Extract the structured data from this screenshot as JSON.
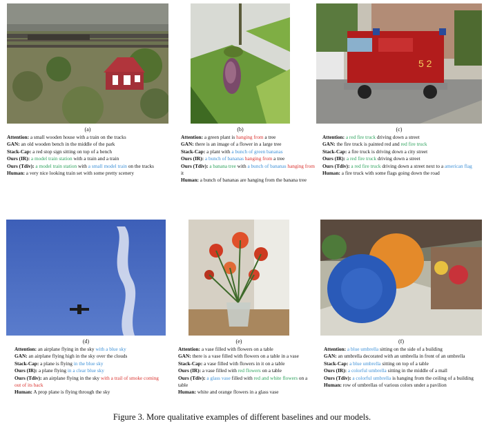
{
  "figure_caption": "Figure 3. More qualitative examples of different baselines and our models.",
  "panels": [
    {
      "label": "(a)",
      "captions": [
        {
          "method": "Attention:",
          "segments": [
            {
              "t": " a small wooden house with a train on the tracks",
              "c": ""
            }
          ]
        },
        {
          "method": "GAN:",
          "segments": [
            {
              "t": " an old wooden bench in the middle of the park",
              "c": ""
            }
          ]
        },
        {
          "method": "Stack-Cap:",
          "segments": [
            {
              "t": " a red stop sign sitting on top of a bench",
              "c": ""
            }
          ]
        },
        {
          "method": "Ours (IR):",
          "segments": [
            {
              "t": " ",
              "c": ""
            },
            {
              "t": "a model train station",
              "c": "g"
            },
            {
              "t": " with a train and a train",
              "c": ""
            }
          ]
        },
        {
          "method": "Ours (Tdiv):",
          "segments": [
            {
              "t": " ",
              "c": ""
            },
            {
              "t": "a model train station",
              "c": "g"
            },
            {
              "t": " with ",
              "c": ""
            },
            {
              "t": "a small model train",
              "c": "b"
            },
            {
              "t": " on the tracks",
              "c": ""
            }
          ]
        },
        {
          "method": "Human:",
          "segments": [
            {
              "t": " a very nice looking train set with some pretty scenery",
              "c": ""
            }
          ]
        }
      ]
    },
    {
      "label": "(b)",
      "captions": [
        {
          "method": "Attention:",
          "segments": [
            {
              "t": " a green plant is ",
              "c": ""
            },
            {
              "t": "hanging from",
              "c": "r"
            },
            {
              "t": " a tree",
              "c": ""
            }
          ]
        },
        {
          "method": "GAN:",
          "segments": [
            {
              "t": " there is an image of a flower in a large tree",
              "c": ""
            }
          ]
        },
        {
          "method": "Stack-Cap:",
          "segments": [
            {
              "t": " a plant with ",
              "c": ""
            },
            {
              "t": "a bunch of green bananas",
              "c": "b"
            }
          ]
        },
        {
          "method": "Ours (IR):",
          "segments": [
            {
              "t": " ",
              "c": ""
            },
            {
              "t": "a bunch of bananas",
              "c": "b"
            },
            {
              "t": " ",
              "c": ""
            },
            {
              "t": "hanging from",
              "c": "r"
            },
            {
              "t": " a tree",
              "c": ""
            }
          ]
        },
        {
          "method": "Ours (Tdiv):",
          "segments": [
            {
              "t": " ",
              "c": ""
            },
            {
              "t": "a banana tree",
              "c": "g"
            },
            {
              "t": " with ",
              "c": ""
            },
            {
              "t": "a bunch of bananas",
              "c": "b"
            },
            {
              "t": " ",
              "c": ""
            },
            {
              "t": "hanging from",
              "c": "r"
            },
            {
              "t": " it",
              "c": ""
            }
          ]
        },
        {
          "method": "Human:",
          "segments": [
            {
              "t": " a bunch of bananas are hanging from the banana tree",
              "c": ""
            }
          ]
        }
      ]
    },
    {
      "label": "(c)",
      "captions": [
        {
          "method": "Attention:",
          "segments": [
            {
              "t": " ",
              "c": ""
            },
            {
              "t": "a red fire truck",
              "c": "g"
            },
            {
              "t": " driving down a street",
              "c": ""
            }
          ]
        },
        {
          "method": "GAN:",
          "segments": [
            {
              "t": " the fire truck is painted red and ",
              "c": ""
            },
            {
              "t": "red fire truck",
              "c": "g"
            }
          ]
        },
        {
          "method": "Stack-Cap:",
          "segments": [
            {
              "t": " a fire truck is driving down a city street",
              "c": ""
            }
          ]
        },
        {
          "method": "Ours (IR):",
          "segments": [
            {
              "t": " ",
              "c": ""
            },
            {
              "t": "a red fire truck",
              "c": "g"
            },
            {
              "t": " driving down a street",
              "c": ""
            }
          ]
        },
        {
          "method": "Ours (Tdiv):",
          "segments": [
            {
              "t": " ",
              "c": ""
            },
            {
              "t": "a red fire truck",
              "c": "g"
            },
            {
              "t": " driving down a street next to a ",
              "c": ""
            },
            {
              "t": "american flag",
              "c": "b"
            }
          ]
        },
        {
          "method": "Human:",
          "segments": [
            {
              "t": " a fire truck with some flags going down the road",
              "c": ""
            }
          ]
        }
      ]
    },
    {
      "label": "(d)",
      "captions": [
        {
          "method": "Attention:",
          "segments": [
            {
              "t": " an airplane flying in the sky ",
              "c": ""
            },
            {
              "t": "with a blue sky",
              "c": "b"
            }
          ]
        },
        {
          "method": "GAN:",
          "segments": [
            {
              "t": " an airplane flying high in the sky over the clouds",
              "c": ""
            }
          ]
        },
        {
          "method": "Stack-Cap:",
          "segments": [
            {
              "t": " a plane is flying ",
              "c": ""
            },
            {
              "t": "in the blue sky",
              "c": "b"
            }
          ]
        },
        {
          "method": "Ours (IR):",
          "segments": [
            {
              "t": " a plane flying ",
              "c": ""
            },
            {
              "t": "in a clear blue sky",
              "c": "b"
            }
          ]
        },
        {
          "method": "Ours (Tdiv):",
          "segments": [
            {
              "t": " an airplane flying in the sky ",
              "c": ""
            },
            {
              "t": "with a trail of smoke coming out of its back",
              "c": "r"
            }
          ]
        },
        {
          "method": "Human:",
          "segments": [
            {
              "t": " A prop plane is flying through the sky",
              "c": ""
            }
          ]
        }
      ]
    },
    {
      "label": "(e)",
      "captions": [
        {
          "method": "Attention:",
          "segments": [
            {
              "t": " a vase filled with flowers on a table",
              "c": ""
            }
          ]
        },
        {
          "method": "GAN:",
          "segments": [
            {
              "t": " there is a vase filled with flowers on a table in a vase",
              "c": ""
            }
          ]
        },
        {
          "method": "Stack-Cap:",
          "segments": [
            {
              "t": " a vase filled with flowers in it on a table",
              "c": ""
            }
          ]
        },
        {
          "method": "Ours (IR):",
          "segments": [
            {
              "t": " a vase filled with ",
              "c": ""
            },
            {
              "t": "red flowers",
              "c": "g"
            },
            {
              "t": " on a table",
              "c": ""
            }
          ]
        },
        {
          "method": "Ours (Tdiv):",
          "segments": [
            {
              "t": " ",
              "c": ""
            },
            {
              "t": "a glass vase",
              "c": "b"
            },
            {
              "t": " filled with ",
              "c": ""
            },
            {
              "t": "red and white flowers",
              "c": "g"
            },
            {
              "t": " on a table",
              "c": ""
            }
          ]
        },
        {
          "method": "Human:",
          "segments": [
            {
              "t": " white and orange flowers in a glass vase",
              "c": ""
            }
          ]
        }
      ]
    },
    {
      "label": "(f)",
      "captions": [
        {
          "method": "Attention:",
          "segments": [
            {
              "t": " ",
              "c": ""
            },
            {
              "t": "a blue umbrella",
              "c": "b"
            },
            {
              "t": " sitting on the side of a building",
              "c": ""
            }
          ]
        },
        {
          "method": "GAN:",
          "segments": [
            {
              "t": " an umbrella decorated with an umbrella in front of an umbrella",
              "c": ""
            }
          ]
        },
        {
          "method": "Stack-Cap:",
          "segments": [
            {
              "t": " ",
              "c": ""
            },
            {
              "t": "a blue umbrella",
              "c": "b"
            },
            {
              "t": " sitting on top of a table",
              "c": ""
            }
          ]
        },
        {
          "method": "Ours (IR):",
          "segments": [
            {
              "t": " ",
              "c": ""
            },
            {
              "t": "a colorful umbrella",
              "c": "b"
            },
            {
              "t": " sitting in the middle of a mall",
              "c": ""
            }
          ]
        },
        {
          "method": "Ours (Tdiv):",
          "segments": [
            {
              "t": " ",
              "c": ""
            },
            {
              "t": "a colorful umbrella",
              "c": "b"
            },
            {
              "t": " is hanging from the ceiling of a building",
              "c": ""
            }
          ]
        },
        {
          "method": "Human:",
          "segments": [
            {
              "t": " row of umbrellas of various colors under a pavilion",
              "c": ""
            }
          ]
        }
      ]
    }
  ]
}
